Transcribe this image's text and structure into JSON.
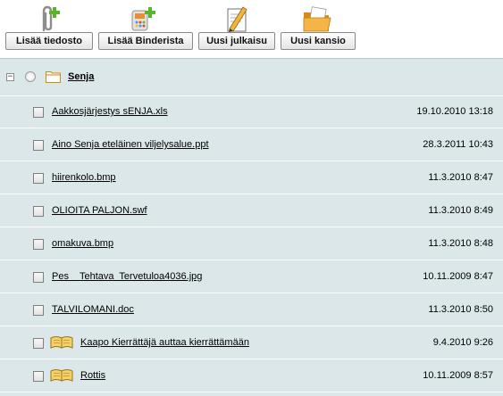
{
  "toolbar": {
    "buttons": [
      {
        "label": "Lisää tiedosto",
        "icon": "paperclip-add-icon"
      },
      {
        "label": "Lisää Binderista",
        "icon": "binder-add-icon"
      },
      {
        "label": "Uusi julkaisu",
        "icon": "new-publication-icon"
      },
      {
        "label": "Uusi kansio",
        "icon": "new-folder-icon"
      }
    ]
  },
  "folder": {
    "name": "Senja",
    "expanded_marker": "−",
    "items": [
      {
        "name": "Aakkosjärjestys sENJA.xls",
        "date": "19.10.2010 13:18",
        "type": "file"
      },
      {
        "name": "Aino Senja eteläinen viljelysalue.ppt",
        "date": "28.3.2011 10:43",
        "type": "file"
      },
      {
        "name": "hiirenkolo.bmp",
        "date": "11.3.2010 8:47",
        "type": "file"
      },
      {
        "name": "OLIOITA PALJON.swf",
        "date": "11.3.2010 8:49",
        "type": "file"
      },
      {
        "name": "omakuva.bmp",
        "date": "11.3.2010 8:48",
        "type": "file"
      },
      {
        "name": "Pes    Tehtava  Tervetuloa4036.jpg",
        "date": "10.11.2009 8:47",
        "type": "file"
      },
      {
        "name": "TALVILOMANI.doc",
        "date": "11.3.2010 8:50",
        "type": "file"
      },
      {
        "name": "Kaapo Kierrättäjä auttaa kierrättämään",
        "date": "9.4.2010 9:26",
        "type": "publication"
      },
      {
        "name": "Rottis",
        "date": "10.11.2009 8:57",
        "type": "publication"
      }
    ]
  },
  "colors": {
    "panel_bg": "#dbe7e8",
    "folder_icon": "#f0a830",
    "plus_green": "#58b52c"
  }
}
